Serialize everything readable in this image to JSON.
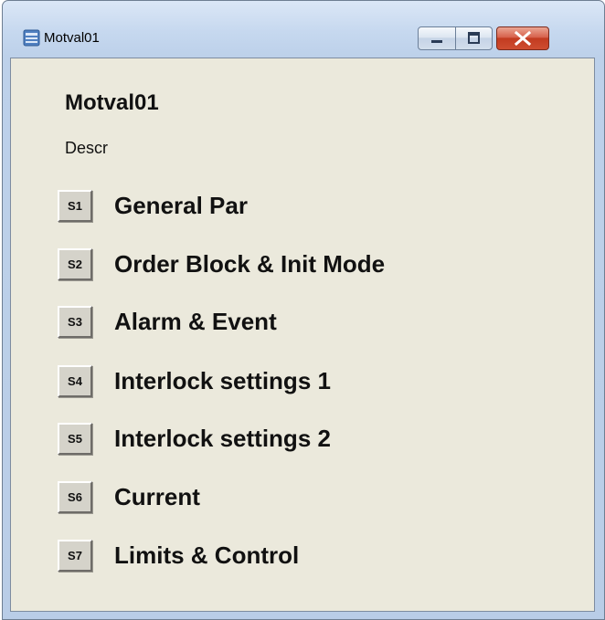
{
  "window": {
    "title": "Motval01",
    "icon": "app-window-icon",
    "controls": [
      "minimize",
      "maximize",
      "close"
    ]
  },
  "content": {
    "heading": "Motval01",
    "description": "Descr"
  },
  "menu": [
    {
      "button": "S1",
      "label": "General Par"
    },
    {
      "button": "S2",
      "label": "Order Block & Init Mode"
    },
    {
      "button": "S3",
      "label": "Alarm & Event"
    },
    {
      "button": "S4",
      "label": "Interlock settings 1"
    },
    {
      "button": "S5",
      "label": "Interlock settings 2"
    },
    {
      "button": "S6",
      "label": "Current"
    },
    {
      "button": "S7",
      "label": "Limits & Control"
    }
  ]
}
